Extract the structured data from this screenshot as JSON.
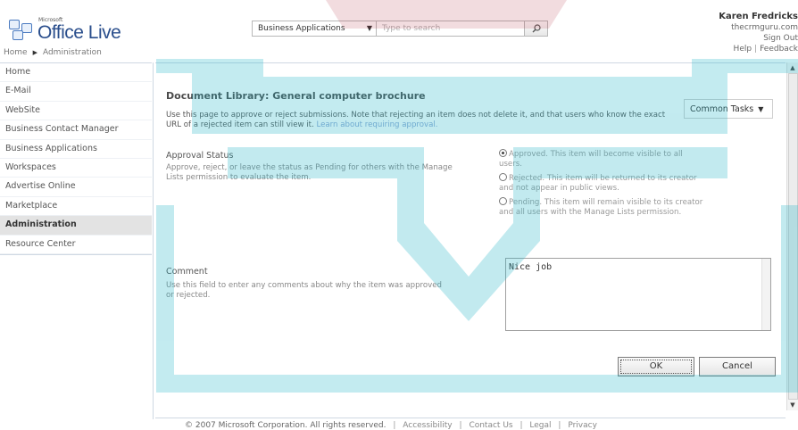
{
  "header": {
    "logo_ms": "Microsoft",
    "logo_text": "Office Live",
    "scope_value": "Business Applications",
    "search_placeholder": "Type to search",
    "user_name": "Karen Fredricks",
    "user_domain": "thecrmguru.com",
    "sign_out": "Sign Out",
    "help": "Help",
    "feedback": "Feedback",
    "help_sep": "|"
  },
  "breadcrumb": {
    "home": "Home",
    "current": "Administration"
  },
  "sidebar": {
    "items": [
      {
        "label": "Home"
      },
      {
        "label": "E-Mail"
      },
      {
        "label": "WebSite"
      },
      {
        "label": "Business Contact Manager"
      },
      {
        "label": "Business Applications"
      },
      {
        "label": "Workspaces"
      },
      {
        "label": "Advertise Online"
      },
      {
        "label": "Marketplace"
      },
      {
        "label": "Administration"
      },
      {
        "label": "Resource Center"
      }
    ]
  },
  "main": {
    "title": "Document Library: General computer brochure",
    "intro": "Use this page to approve or reject submissions. Note that rejecting an item does not delete it, and that users who know the exact URL of a rejected item can still view it.",
    "learn_more": "Learn about requiring approval.",
    "common_tasks": "Common Tasks",
    "approval_label": "Approval Status",
    "approval_desc": "Approve, reject, or leave the status as Pending for others with the Manage Lists permission to evaluate the item.",
    "radios": [
      {
        "label": "Approved. This item will become visible to all users."
      },
      {
        "label": "Rejected. This item will be returned to its creator and not appear in public views."
      },
      {
        "label": "Pending. This item will remain visible to its creator and all users with the Manage Lists permission."
      }
    ],
    "comment_label": "Comment",
    "comment_desc": "Use this field to enter any comments about why the item was approved or rejected.",
    "comment_value": "Nice job",
    "ok": "OK",
    "cancel": "Cancel"
  },
  "footer": {
    "copyright": "© 2007 Microsoft Corporation. All rights reserved.",
    "accessibility": "Accessibility",
    "contact": "Contact Us",
    "legal": "Legal",
    "privacy": "Privacy",
    "sep": "|"
  },
  "colors": {
    "accent": "#2a4e8c",
    "link": "#8aa6d4",
    "watermark": "#29b6c8"
  }
}
